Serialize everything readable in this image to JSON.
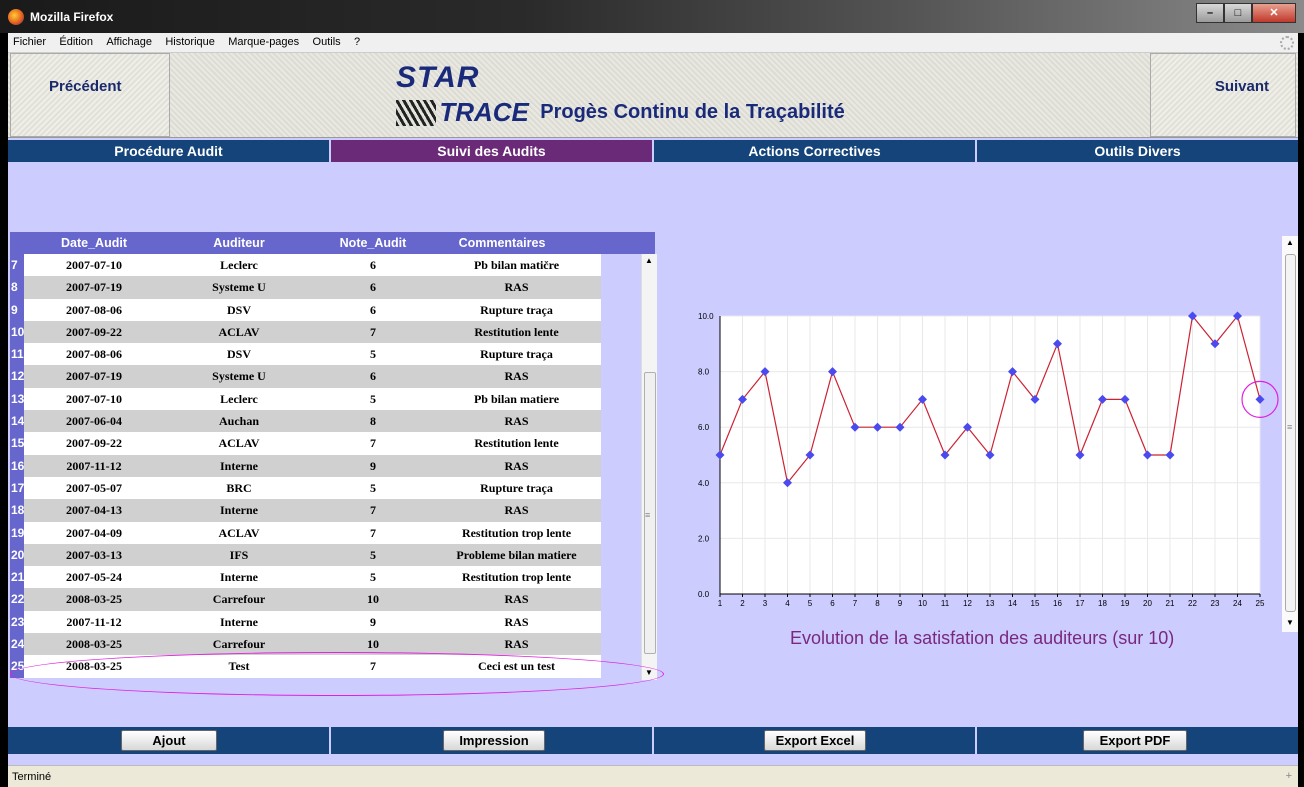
{
  "window": {
    "title": "Mozilla Firefox"
  },
  "menu": [
    "Fichier",
    "Édition",
    "Affichage",
    "Historique",
    "Marque-pages",
    "Outils",
    "?"
  ],
  "banner": {
    "prev": "Précédent",
    "next": "Suivant",
    "logo_top": "STAR",
    "logo_bottom": "TRACE",
    "tagline": "Progès Continu de la Traçabilité"
  },
  "tabs": [
    {
      "label": "Procédure Audit",
      "active": false
    },
    {
      "label": "Suivi des Audits",
      "active": true
    },
    {
      "label": "Actions Correctives",
      "active": false
    },
    {
      "label": "Outils Divers",
      "active": false
    }
  ],
  "table": {
    "columns": [
      "Date_Audit",
      "Auditeur",
      "Note_Audit",
      "Commentaires"
    ],
    "rows": [
      {
        "n": "7",
        "date": "2007-07-10",
        "auditeur": "Leclerc",
        "note": "6",
        "com": "Pb bilan matičre"
      },
      {
        "n": "8",
        "date": "2007-07-19",
        "auditeur": "Systeme U",
        "note": "6",
        "com": "RAS"
      },
      {
        "n": "9",
        "date": "2007-08-06",
        "auditeur": "DSV",
        "note": "6",
        "com": "Rupture traça"
      },
      {
        "n": "10",
        "date": "2007-09-22",
        "auditeur": "ACLAV",
        "note": "7",
        "com": "Restitution lente"
      },
      {
        "n": "11",
        "date": "2007-08-06",
        "auditeur": "DSV",
        "note": "5",
        "com": "Rupture traça"
      },
      {
        "n": "12",
        "date": "2007-07-19",
        "auditeur": "Systeme U",
        "note": "6",
        "com": "RAS"
      },
      {
        "n": "13",
        "date": "2007-07-10",
        "auditeur": "Leclerc",
        "note": "5",
        "com": "Pb bilan matiere"
      },
      {
        "n": "14",
        "date": "2007-06-04",
        "auditeur": "Auchan",
        "note": "8",
        "com": "RAS"
      },
      {
        "n": "15",
        "date": "2007-09-22",
        "auditeur": "ACLAV",
        "note": "7",
        "com": "Restitution lente"
      },
      {
        "n": "16",
        "date": "2007-11-12",
        "auditeur": "Interne",
        "note": "9",
        "com": "RAS"
      },
      {
        "n": "17",
        "date": "2007-05-07",
        "auditeur": "BRC",
        "note": "5",
        "com": "Rupture traça"
      },
      {
        "n": "18",
        "date": "2007-04-13",
        "auditeur": "Interne",
        "note": "7",
        "com": "RAS"
      },
      {
        "n": "19",
        "date": "2007-04-09",
        "auditeur": "ACLAV",
        "note": "7",
        "com": "Restitution trop lente"
      },
      {
        "n": "20",
        "date": "2007-03-13",
        "auditeur": "IFS",
        "note": "5",
        "com": "Probleme bilan matiere"
      },
      {
        "n": "21",
        "date": "2007-05-24",
        "auditeur": "Interne",
        "note": "5",
        "com": "Restitution trop lente"
      },
      {
        "n": "22",
        "date": "2008-03-25",
        "auditeur": "Carrefour",
        "note": "10",
        "com": "RAS"
      },
      {
        "n": "23",
        "date": "2007-11-12",
        "auditeur": "Interne",
        "note": "9",
        "com": "RAS"
      },
      {
        "n": "24",
        "date": "2008-03-25",
        "auditeur": "Carrefour",
        "note": "10",
        "com": "RAS"
      },
      {
        "n": "25",
        "date": "2008-03-25",
        "auditeur": "Test",
        "note": "7",
        "com": "Ceci est un test"
      }
    ]
  },
  "chart_data": {
    "type": "line",
    "title": "Evolution de la satisfation des auditeurs (sur 10)",
    "x": [
      1,
      2,
      3,
      4,
      5,
      6,
      7,
      8,
      9,
      10,
      11,
      12,
      13,
      14,
      15,
      16,
      17,
      18,
      19,
      20,
      21,
      22,
      23,
      24,
      25
    ],
    "series": [
      {
        "values": [
          5,
          7,
          8,
          4,
          5,
          8,
          6,
          6,
          6,
          7,
          5,
          6,
          5,
          8,
          7,
          9,
          5,
          7,
          7,
          5,
          5,
          10,
          9,
          10,
          7
        ]
      }
    ],
    "ylim": [
      0,
      10
    ],
    "yticks": [
      "0.0",
      "2.0",
      "4.0",
      "6.0",
      "8.0",
      "10.0"
    ],
    "grid": true,
    "line_color": "#cc2233",
    "point_color": "#4a4aee",
    "highlight_point": 25
  },
  "buttons": [
    "Ajout",
    "Impression",
    "Export Excel",
    "Export PDF"
  ],
  "status": "Terminé"
}
